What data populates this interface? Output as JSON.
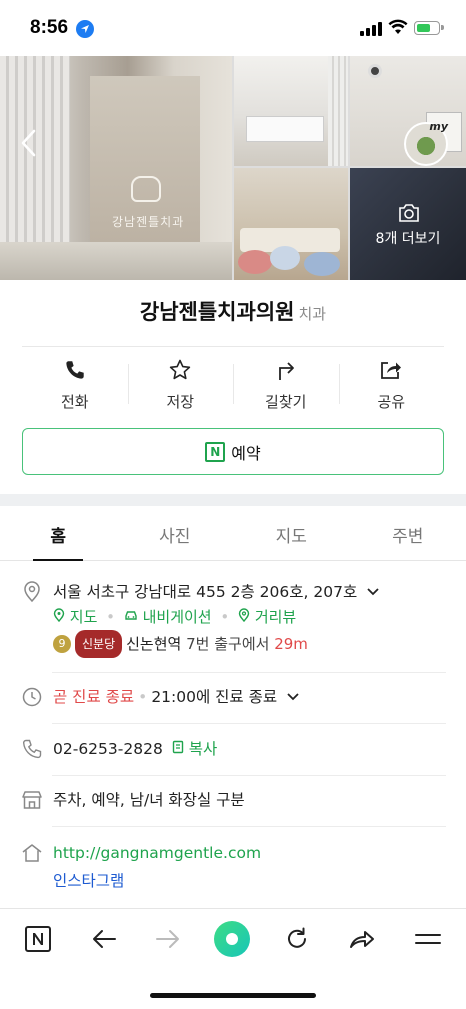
{
  "status_bar": {
    "time": "8:56"
  },
  "gallery": {
    "sign_text": "강남젠틀치과",
    "more_photos_label": "8개 더보기",
    "my_badge": "my"
  },
  "place": {
    "name": "강남젠틀치과의원",
    "category": "치과"
  },
  "actions": [
    {
      "label": "전화",
      "icon": "phone-icon"
    },
    {
      "label": "저장",
      "icon": "star-icon"
    },
    {
      "label": "길찾기",
      "icon": "directions-icon"
    },
    {
      "label": "공유",
      "icon": "share-icon"
    }
  ],
  "reserve": {
    "badge": "N",
    "label": "예약"
  },
  "tabs": [
    {
      "label": "홈",
      "active": true
    },
    {
      "label": "사진",
      "active": false
    },
    {
      "label": "지도",
      "active": false
    },
    {
      "label": "주변",
      "active": false
    }
  ],
  "address": {
    "text": "서울 서초구 강남대로 455 2층 206호, 207호",
    "links": [
      "지도",
      "내비게이션",
      "거리뷰"
    ],
    "subway_line": "9",
    "subway_badge": "신분당",
    "station": "신논현역",
    "exit_text": "7번 출구에서",
    "distance": "29m"
  },
  "hours": {
    "status": "곧 진료 종료",
    "detail": "21:00에 진료 종료"
  },
  "phone": {
    "number": "02-6253-2828",
    "copy_label": "복사"
  },
  "amenities": {
    "text": "주차, 예약, 남/녀 화장실 구분"
  },
  "website": {
    "url": "http://gangnamgentle.com",
    "instagram": "인스타그램"
  },
  "colors": {
    "green": "#1fa34d",
    "red": "#e04a4a",
    "blue": "#1e5bd1",
    "accent_teal": "#2ecf8f"
  }
}
